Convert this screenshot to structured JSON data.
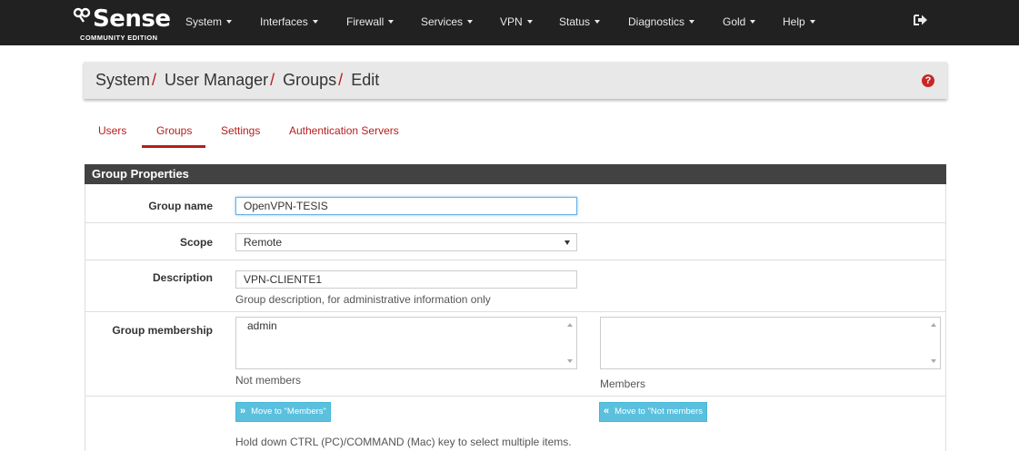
{
  "navbar": {
    "logo_word": "Sense",
    "logo_edition": "COMMUNITY EDITION",
    "menu": [
      "System",
      "Interfaces",
      "Firewall",
      "Services",
      "VPN",
      "Status",
      "Diagnostics",
      "Gold",
      "Help"
    ]
  },
  "breadcrumb": {
    "items": [
      "System",
      "User Manager",
      "Groups",
      "Edit"
    ],
    "separator": "/"
  },
  "tabs": [
    "Users",
    "Groups",
    "Settings",
    "Authentication Servers"
  ],
  "active_tab": "Groups",
  "panel": {
    "title": "Group Properties"
  },
  "form": {
    "group_name": {
      "label": "Group name",
      "value": "OpenVPN-TESIS"
    },
    "scope": {
      "label": "Scope",
      "value": "Remote"
    },
    "description": {
      "label": "Description",
      "value": "VPN-CLIENTE1",
      "help": "Group description, for administrative information only"
    },
    "membership": {
      "label": "Group membership",
      "not_members_options": [
        "admin"
      ],
      "not_members_caption": "Not members",
      "members_options": [],
      "members_caption": "Members",
      "move_to_members_label": "Move to \"Members\"",
      "move_to_not_members_label": "Move to \"Not members",
      "help": "Hold down CTRL (PC)/COMMAND (Mac) key to select multiple items."
    }
  },
  "colors": {
    "navbar_bg": "#212121",
    "accent_red": "#b71c1c",
    "panel_head_bg": "#424242",
    "button_info": "#5bc0de"
  },
  "icons": {
    "logout": "sign-out-icon",
    "help": "question-circle-icon",
    "double_right": "angle-double-right-icon",
    "double_left": "angle-double-left-icon"
  }
}
